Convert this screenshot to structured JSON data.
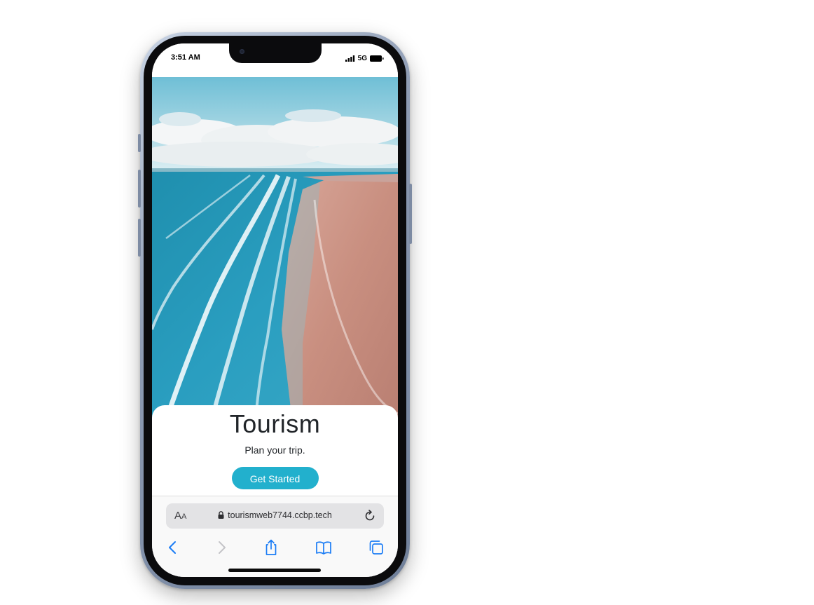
{
  "status_bar": {
    "time": "3:51 AM",
    "network": "5G",
    "icons": [
      "signal-icon",
      "battery-icon"
    ]
  },
  "hero": {
    "image": "aerial-beach-photo"
  },
  "card": {
    "title": "Tourism",
    "subtitle": "Plan your trip.",
    "button_label": "Get Started"
  },
  "browser": {
    "text_size_label_big": "A",
    "text_size_label_small": "A",
    "url": "tourismweb7744.ccbp.tech",
    "icons": [
      "lock-icon",
      "reload-icon",
      "back-icon",
      "forward-icon",
      "share-icon",
      "bookmarks-icon",
      "tabs-icon"
    ]
  },
  "colors": {
    "accent": "#22b0cd",
    "safari_blue": "#1a7cf5",
    "title_text": "#212529"
  }
}
